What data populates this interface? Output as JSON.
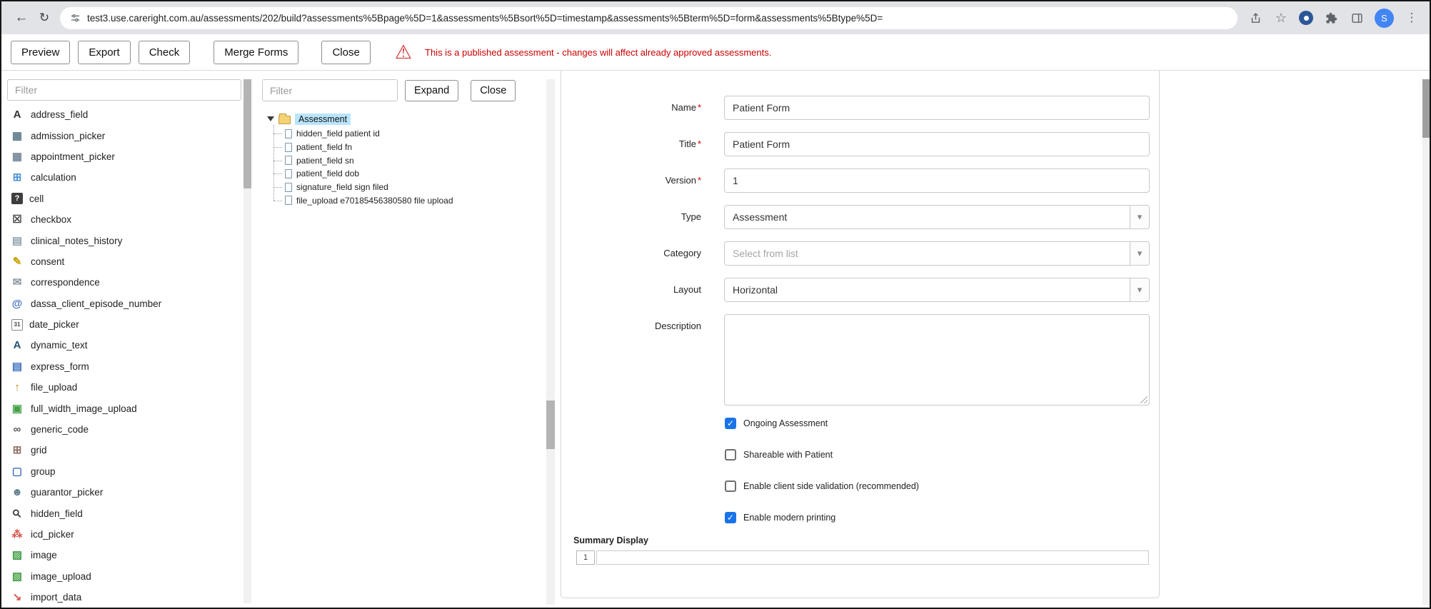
{
  "browser": {
    "url": "test3.use.careright.com.au/assessments/202/build?assessments%5Bpage%5D=1&assessments%5Bsort%5D=timestamp&assessments%5Bterm%5D=form&assessments%5Btype%5D=",
    "avatar_initial": "S"
  },
  "toolbar": {
    "buttons": [
      "Preview",
      "Export",
      "Check",
      "Merge Forms",
      "Close"
    ],
    "warning_text": "This is a published assessment - changes will affect already approved assessments."
  },
  "palette": {
    "filter_placeholder": "Filter",
    "items": [
      {
        "label": "address_field",
        "icon": "address-field-icon",
        "glyph": "A",
        "color": "#333333",
        "style": "plain"
      },
      {
        "label": "admission_picker",
        "icon": "admission-picker-icon",
        "glyph": "▦",
        "color": "#607d8b",
        "style": "plain"
      },
      {
        "label": "appointment_picker",
        "icon": "appointment-picker-icon",
        "glyph": "▦",
        "color": "#778899",
        "style": "plain"
      },
      {
        "label": "calculation",
        "icon": "calculation-icon",
        "glyph": "⊞",
        "color": "#4a90d9",
        "style": "plain"
      },
      {
        "label": "cell",
        "icon": "cell-icon",
        "glyph": "?",
        "color": "#ffffff",
        "style": "dark"
      },
      {
        "label": "checkbox",
        "icon": "checkbox-icon",
        "glyph": "☒",
        "color": "#444444",
        "style": "plain"
      },
      {
        "label": "clinical_notes_history",
        "icon": "clinical-notes-history-icon",
        "glyph": "▤",
        "color": "#90a4ae",
        "style": "plain"
      },
      {
        "label": "consent",
        "icon": "consent-icon",
        "glyph": "✎",
        "color": "#c8a200",
        "style": "plain"
      },
      {
        "label": "correspondence",
        "icon": "correspondence-icon",
        "glyph": "✉",
        "color": "#8a959e",
        "style": "plain"
      },
      {
        "label": "dassa_client_episode_number",
        "icon": "dassa-client-episode-number-icon",
        "glyph": "@",
        "color": "#3f6fbf",
        "style": "plain"
      },
      {
        "label": "date_picker",
        "icon": "date-picker-icon",
        "glyph": "31",
        "color": "#444444",
        "style": "boxed"
      },
      {
        "label": "dynamic_text",
        "icon": "dynamic-text-icon",
        "glyph": "A",
        "color": "#23527c",
        "style": "plain"
      },
      {
        "label": "express_form",
        "icon": "express-form-icon",
        "glyph": "▤",
        "color": "#3f6fbf",
        "style": "plain"
      },
      {
        "label": "file_upload",
        "icon": "file-upload-icon",
        "glyph": "↑",
        "color": "#c8881a",
        "style": "plain"
      },
      {
        "label": "full_width_image_upload",
        "icon": "full-width-image-upload-icon",
        "glyph": "▣",
        "color": "#43a047",
        "style": "plain"
      },
      {
        "label": "generic_code",
        "icon": "generic-code-icon",
        "glyph": "∞",
        "color": "#555555",
        "style": "plain"
      },
      {
        "label": "grid",
        "icon": "grid-icon",
        "glyph": "⊞",
        "color": "#8d6e63",
        "style": "plain"
      },
      {
        "label": "group",
        "icon": "group-icon",
        "glyph": "▢",
        "color": "#3f6fbf",
        "style": "plain"
      },
      {
        "label": "guarantor_picker",
        "icon": "guarantor-picker-icon",
        "glyph": "☻",
        "color": "#607d8b",
        "style": "plain"
      },
      {
        "label": "hidden_field",
        "icon": "hidden-field-icon",
        "glyph": "⚲",
        "color": "#444444",
        "style": "magnifier"
      },
      {
        "label": "icd_picker",
        "icon": "icd-picker-icon",
        "glyph": "⁂",
        "color": "#d9534f",
        "style": "plain"
      },
      {
        "label": "image",
        "icon": "image-icon",
        "glyph": "▨",
        "color": "#43a047",
        "style": "plain"
      },
      {
        "label": "image_upload",
        "icon": "image-upload-icon",
        "glyph": "▧",
        "color": "#43a047",
        "style": "plain"
      },
      {
        "label": "import_data",
        "icon": "import-data-icon",
        "glyph": "↘",
        "color": "#d9534f",
        "style": "plain"
      }
    ]
  },
  "tree_panel": {
    "filter_placeholder": "Filter",
    "expand_label": "Expand",
    "close_label": "Close",
    "root_label": "Assessment",
    "children": [
      "hidden_field patient id",
      "patient_field fn",
      "patient_field sn",
      "patient_field dob",
      "signature_field sign filed",
      "file_upload e70185456380580 file upload"
    ]
  },
  "properties": {
    "fields": [
      {
        "label": "Name",
        "required": true,
        "control": "text",
        "value": "Patient Form"
      },
      {
        "label": "Title",
        "required": true,
        "control": "text",
        "value": "Patient Form"
      },
      {
        "label": "Version",
        "required": true,
        "control": "text",
        "value": "1"
      },
      {
        "label": "Type",
        "required": false,
        "control": "select",
        "value": "Assessment",
        "muted": false
      },
      {
        "label": "Category",
        "required": false,
        "control": "select",
        "value": "Select from list",
        "muted": true
      },
      {
        "label": "Layout",
        "required": false,
        "control": "select",
        "value": "Horizontal",
        "muted": false
      },
      {
        "label": "Description",
        "required": false,
        "control": "textarea",
        "value": ""
      }
    ],
    "checkboxes": [
      {
        "label": "Ongoing Assessment",
        "checked": true
      },
      {
        "label": "Shareable with Patient",
        "checked": false
      },
      {
        "label": "Enable client side validation (recommended)",
        "checked": false
      },
      {
        "label": "Enable modern printing",
        "checked": true
      }
    ],
    "summary_display_label": "Summary Display",
    "summary_row_number": "1"
  },
  "colors": {
    "accent_blue": "#1a73e8",
    "warning_red": "#cc0000",
    "tree_selection": "#b9e5fb",
    "chrome_bg": "#e1e3e7"
  }
}
